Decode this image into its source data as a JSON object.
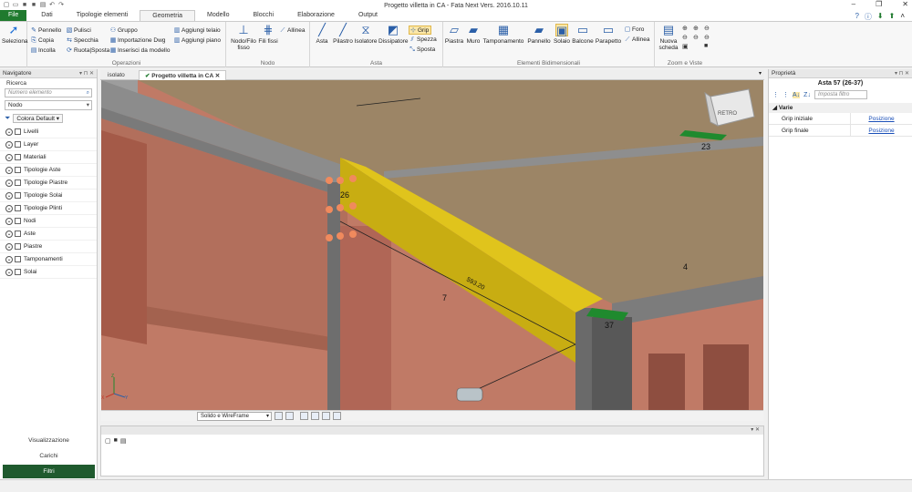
{
  "app": {
    "title": "Progetto villetta in CA - Fata Next Vers. 2016.10.11"
  },
  "tabs": [
    "File",
    "Dati",
    "Tipologie elementi",
    "Geometria",
    "Modello",
    "Blocchi",
    "Elaborazione",
    "Output"
  ],
  "ribbon": {
    "selezione": "Seleziona",
    "operazioni": {
      "label": "Operazioni",
      "items": [
        "Pennello",
        "Copia",
        "Incolla",
        "Pulisci",
        "Specchia",
        "Ruota|Sposta",
        "Gruppo",
        "Importazione Dwg",
        "Inserisci da modello",
        "Aggiungi telaio",
        "Aggiungi piano"
      ]
    },
    "nodo": {
      "label": "Nodo",
      "items": [
        "Nodo/Filo fisso",
        "Fili fissi",
        "Allinea"
      ]
    },
    "asta": {
      "label": "Asta",
      "items": [
        "Asta",
        "Pilastro",
        "Isolatore",
        "Dissipatore",
        "Grip",
        "Spezza",
        "Sposta"
      ]
    },
    "bidim": {
      "label": "Elementi Bidimensionali",
      "items": [
        "Piastra",
        "Muro",
        "Tamponamento",
        "Pannello",
        "Solaio",
        "Balcone",
        "Parapetto",
        "Foro",
        "Allinea"
      ]
    },
    "zoom": {
      "label": "Zoom e Viste",
      "items": [
        "Nuova scheda"
      ]
    }
  },
  "navigator": {
    "title": "Navigatore",
    "search_label": "Ricerca",
    "search_placeholder": "Numero elemento",
    "selector": "Nodo",
    "color_label": "Colora Default",
    "items": [
      "Livelli",
      "Layer",
      "Materiali",
      "Tipologie Aste",
      "Tipologie Piastre",
      "Tipologie Solai",
      "Tipologie Plinti",
      "Nodi",
      "Aste",
      "Piastre",
      "Tamponamenti",
      "Solai"
    ],
    "bottom_buttons": [
      "Visualizzazione",
      "Carichi",
      "Filtri"
    ]
  },
  "doc_tabs": [
    "isolato",
    "Progetto villetta in CA"
  ],
  "viewport": {
    "labels": {
      "n23": "23",
      "n26": "26",
      "n37": "37",
      "n4": "4",
      "n7": "7",
      "dim": "593.20"
    },
    "cube_label": "RETRO",
    "view_mode": "Solido e WireFrame",
    "axis": {
      "x": "X",
      "y": "Y",
      "z": "Z"
    }
  },
  "properties": {
    "title": "Proprietà",
    "element": "Asta 57 (26-37)",
    "filter_placeholder": "Imposta filtro",
    "category": "Varie",
    "rows": [
      {
        "key": "Grip iniziale",
        "value": "Posizione"
      },
      {
        "key": "Grip finale",
        "value": "Posizione"
      }
    ]
  },
  "colors": {
    "file_tab": "#1f7a2e",
    "beam": "#d6bd1a",
    "slab": "#a08a68",
    "floor": "#c07a66",
    "column": "#707070",
    "grip": "#f08a5d"
  }
}
